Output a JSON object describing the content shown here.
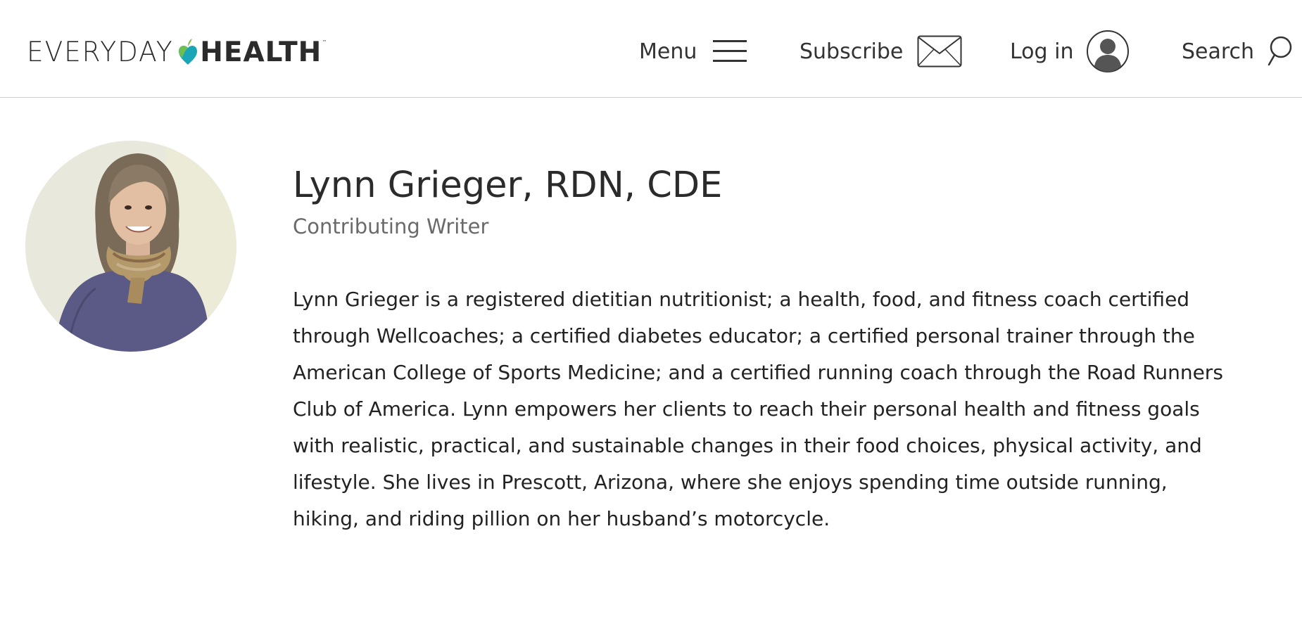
{
  "header": {
    "logo": {
      "word1": "EVERYDAY",
      "word2": "HEALTH",
      "tm": "™"
    },
    "nav": {
      "menu_label": "Menu",
      "subscribe_label": "Subscribe",
      "login_label": "Log in",
      "search_label": "Search"
    }
  },
  "profile": {
    "name": "Lynn Grieger, RDN, CDE",
    "role": "Contributing Writer",
    "bio": "Lynn Grieger is a registered dietitian nutritionist; a health, food, and fitness coach certified through Wellcoaches; a certified diabetes educator; a certified personal trainer through the American College of Sports Medicine; and a certified running coach through the Road Runners Club of America. Lynn empowers her clients to reach their personal health and fitness goals with realistic, practical, and sustainable changes in their food choices, physical activity, and lifestyle. She lives in Prescott, Arizona, where she enjoys spending time outside running, hiking, and riding pillion on her husband’s motorcycle."
  },
  "colors": {
    "text": "#2b2b2b",
    "muted": "#6a6a6a",
    "divider": "#cfcfcf",
    "heart_green": "#7cc242",
    "heart_teal": "#1aa6b7",
    "avatar_bg": "#e8e8dc",
    "shirt": "#5b5a86"
  },
  "icons": {
    "menu": "hamburger-icon",
    "subscribe": "envelope-icon",
    "login": "user-circle-icon",
    "search": "magnifier-icon",
    "logo_heart": "apple-heart-icon"
  }
}
